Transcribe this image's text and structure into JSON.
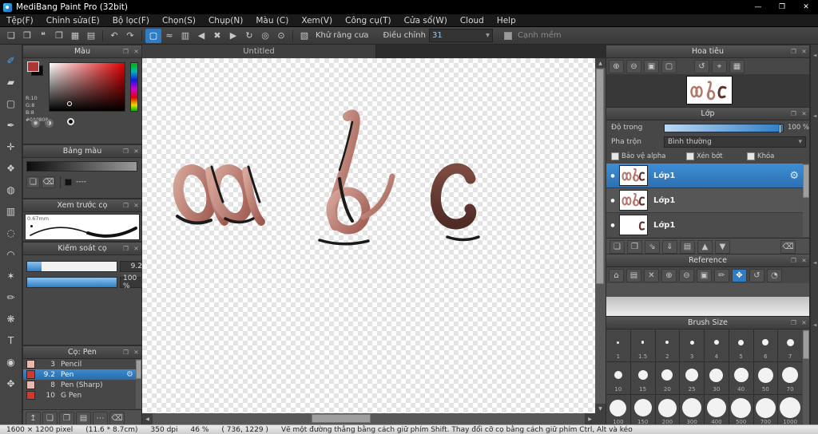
{
  "window": {
    "title": "MediBang Paint Pro (32bit)"
  },
  "menu": {
    "items": [
      "Tệp(F)",
      "Chỉnh sửa(E)",
      "Bộ lọc(F)",
      "Chọn(S)",
      "Chụp(N)",
      "Màu (C)",
      "Xem(V)",
      "Công cụ(T)",
      "Cửa sổ(W)",
      "Cloud",
      "Help"
    ]
  },
  "toolbar": {
    "antialias_label": "Khử răng cưa",
    "adjust_label": "Điều chỉnh",
    "adjust_value": "31",
    "soft_edge_label": "Cạnh mềm"
  },
  "canvas": {
    "tab": "Untitled",
    "zoom": "46 %"
  },
  "panels": {
    "color": {
      "title": "Màu",
      "r": "R:10",
      "g": "G:8",
      "b": "B:8",
      "hex": "#0A0808",
      "fg_color": "#b03434",
      "bg_color": "#0a0808"
    },
    "palette": {
      "title": "Bảng màu",
      "item": "----"
    },
    "brush_preview": {
      "title": "Xem trước cọ",
      "size_label": "0.67mm"
    },
    "brush_control": {
      "title": "Kiểm soát cọ",
      "size_value": "9.2",
      "opacity_value": "100 %"
    },
    "brush_list": {
      "title": "Cọ: Pen",
      "items": [
        {
          "size": "3",
          "name": "Pencil",
          "color": "#e8b9ae",
          "selected": false
        },
        {
          "size": "9.2",
          "name": "Pen",
          "color": "#cc3b33",
          "selected": true
        },
        {
          "size": "8",
          "name": "Pen (Sharp)",
          "color": "#e8b9ae",
          "selected": false
        },
        {
          "size": "10",
          "name": "G Pen",
          "color": "#cc3b33",
          "selected": false
        }
      ]
    },
    "navigator": {
      "title": "Hoa tiêu"
    },
    "layers": {
      "title": "Lớp",
      "opacity_label": "Độ trong",
      "opacity_value": "100 %",
      "blend_label": "Pha trộn",
      "blend_value": "Bình thường",
      "check_labels": [
        "Bảo vệ alpha",
        "Xén bớt",
        "Khóa"
      ],
      "items": [
        {
          "name": "Lớp1",
          "selected": true
        },
        {
          "name": "Lớp1",
          "selected": false
        },
        {
          "name": "Lớp1",
          "selected": false
        }
      ]
    },
    "reference": {
      "title": "Reference"
    },
    "brush_size": {
      "title": "Brush Size",
      "sizes": [
        "1",
        "1.5",
        "2",
        "3",
        "4",
        "5",
        "6",
        "7",
        "10",
        "15",
        "20",
        "25",
        "30",
        "40",
        "50",
        "70",
        "100",
        "150",
        "200",
        "300",
        "400",
        "500",
        "700",
        "1000"
      ]
    }
  },
  "statusbar": {
    "segments": [
      "1600 × 1200 pixel",
      "(11.6 * 8.7cm)",
      "350 dpi",
      "46 %",
      "( 736, 1229 )",
      "Vẽ một đường thẳng bằng cách giữ phím Shift. Thay đổi cỡ cọ bằng cách giữ phím Ctrl, Alt và kéo"
    ]
  },
  "icons": {
    "minimize": "—",
    "maximize": "❐",
    "close": "✕",
    "panel-float": "❐",
    "panel-close": "✕",
    "new-file": "❏",
    "open-file": "❒",
    "comment": "❝",
    "duplicate": "❐",
    "grid": "▦",
    "table": "▤",
    "undo": "↶",
    "redo": "↷",
    "select-rect": "▢",
    "ruled-lines": "≈",
    "layers-stack": "▥",
    "prev": "◀",
    "cancel": "✖",
    "next": "▶",
    "rotate": "↻",
    "snap-circle": "◎",
    "snap-target": "⊙",
    "antialias": "▧",
    "dropdown-arrow": "▾",
    "brush": "✐",
    "eraser": "▰",
    "marquee": "▢",
    "pen": "✒",
    "move": "✛",
    "stamp": "❖",
    "bucket": "◍",
    "gradient": "▥",
    "lasso": "◌",
    "curve": "◠",
    "magic-wand": "✶",
    "pencil": "✏",
    "blur": "❋",
    "text": "T",
    "zoom": "◉",
    "hand": "✥",
    "add": "❏",
    "trash": "⌫",
    "folder": "▤",
    "menu-dots": "⋯",
    "up": "▲",
    "down": "▼",
    "left": "◀",
    "right": "▶",
    "up-arrow": "↥",
    "zoom-in": "⊕",
    "zoom-out": "⊖",
    "zoom-fit": "▣",
    "zoom-100": "▢",
    "rotate-ccw": "↺",
    "crosshair": "⌖",
    "home": "⌂",
    "pipette": "◔",
    "gear": "⚙",
    "eye": "●",
    "merge": "⇓",
    "transfer": "⇘",
    "swap": "⇅",
    "collapse": "◄",
    "spoid": "◑",
    "palette-dot": "◉"
  }
}
